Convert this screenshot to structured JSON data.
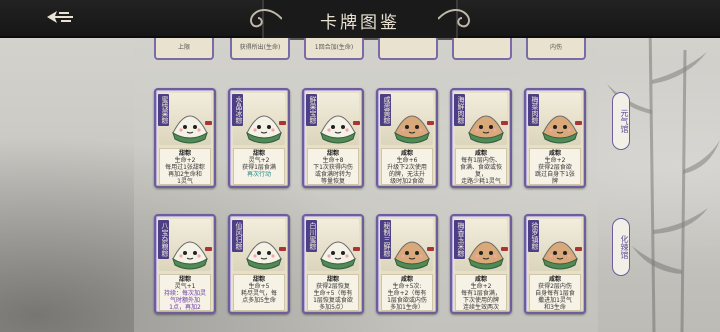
{
  "header": {
    "title": "卡牌图鉴",
    "back_icon": "back-arrow-icon"
  },
  "top_stubs": [
    "上限",
    "获得所出(生命)",
    "1回合加(生命)",
    "",
    "",
    "内伤"
  ],
  "sections": [
    {
      "label": "元气馆"
    },
    {
      "label": "化辣馆"
    }
  ],
  "row1": [
    {
      "name": "蜜饯果粽",
      "type": "甜粽",
      "lines": [
        "生命+2",
        "每用过1张甜粽",
        "再加2生命和",
        "1灵气"
      ],
      "hl": []
    },
    {
      "name": "水晶冰粽",
      "type": "甜粽",
      "lines": [
        "灵气+2",
        "获得1层食满"
      ],
      "hl": [
        "再次行动"
      ]
    },
    {
      "name": "鲜果宝粽",
      "type": "甜粽",
      "lines": [
        "生命+8",
        "下1次获得内伤",
        "或食满时转为",
        "等量恢复"
      ],
      "hl": []
    },
    {
      "name": "咸蛋黄粽",
      "type": "咸粽",
      "lines": [
        "生命+6",
        "升级下2次使用",
        "的牌，无法升",
        "级时加2食欲"
      ],
      "hl": []
    },
    {
      "name": "海鲜肉粽",
      "type": "咸粽",
      "lines": [
        "每有1层内伤、",
        "食满、食欲或恢复，",
        "走路少耗1灵气",
        "恢复4次: 生命+5"
      ],
      "hl": []
    },
    {
      "name": "梅菜肉粽",
      "type": "咸粽",
      "lines": [
        "生命+2",
        "获得2层食欲",
        "跳过自身下1张",
        "牌"
      ],
      "hl": []
    }
  ],
  "row2": [
    {
      "name": "八宝杂粮粽",
      "type": "甜粽",
      "lines": [
        "灵气+1"
      ],
      "kw": [
        "持续：每次加灵",
        "气时额外加",
        "1点，再加2",
        "生命"
      ]
    },
    {
      "name": "仙风归粽",
      "type": "甜粽",
      "lines": [
        "生命+5",
        "耗尽灵气，每",
        "点多加5生命"
      ],
      "kw": []
    },
    {
      "name": "白川蜜粽",
      "type": "甜粽",
      "lines": [
        "获得2层恢复",
        "生命+5（每有",
        "1层恢复或食欲",
        "多加5点）"
      ],
      "kw": []
    },
    {
      "name": "秘制三鲜粽",
      "type": "咸粽",
      "lines": [
        "生命+5次:",
        "生命+2（每有",
        "1层食欲或内伤",
        "多加1生命）"
      ],
      "kw": []
    },
    {
      "name": "梅香玉米粽",
      "type": "咸粽",
      "lines": [
        "生命+2",
        "每有1层食满，",
        "下次使用的牌",
        "连续生效两次"
      ],
      "kw": []
    },
    {
      "name": "徐罗镇粽",
      "type": "咸粽",
      "lines": [
        "获得2层内伤",
        "自身每有1层食",
        "撒进加1灵气",
        "和3生命"
      ],
      "kw": []
    }
  ]
}
